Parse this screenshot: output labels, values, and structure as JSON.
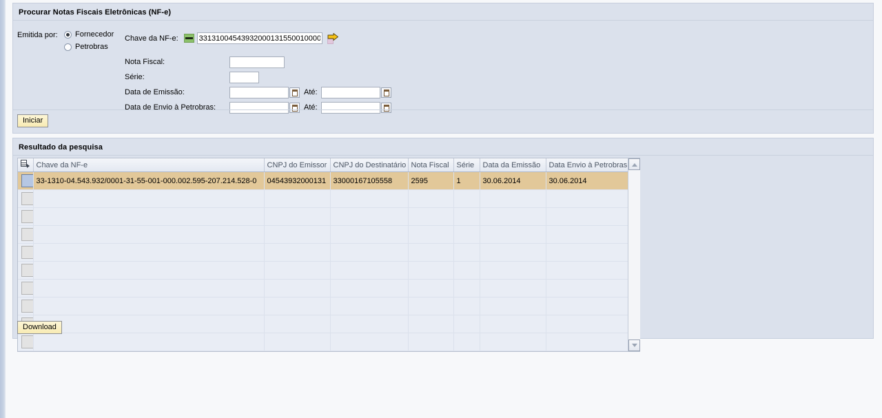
{
  "search_panel": {
    "title": "Procurar Notas Fiscais Eletrônicas (NF-e)",
    "emitida_por_label": "Emitida por:",
    "radios": [
      {
        "label": "Fornecedor",
        "checked": true
      },
      {
        "label": "Petrobras",
        "checked": false
      }
    ],
    "chave": {
      "label": "Chave da NF-e:",
      "value": "33131004543932000131550010000",
      "placeholder": "",
      "key_icon": "green-key-icon",
      "go_icon": "yellow-arrow-icon"
    },
    "fields": [
      {
        "label": "Nota Fiscal:",
        "value": "",
        "type": "text"
      },
      {
        "label": "Série:",
        "value": "",
        "type": "text-small"
      },
      {
        "label": "Data de Emissão:",
        "value": "",
        "ate_label": "Até:",
        "value2": "",
        "type": "date-range"
      },
      {
        "label": "Data de Envio à Petrobras:",
        "value": "",
        "ate_label": "Até:",
        "value2": "",
        "type": "date-range"
      }
    ],
    "start_button": "Iniciar"
  },
  "result_panel": {
    "title": "Resultado da pesquisa",
    "settings_icon": "table-settings-icon",
    "columns": [
      "Chave da NF-e",
      "CNPJ do Emissor",
      "CNPJ do Destinatário",
      "Nota Fiscal",
      "Série",
      "Data da Emissão",
      "Data Envio à Petrobras"
    ],
    "rows": [
      {
        "selected": true,
        "cells": [
          "33-1310-04.543.932/0001-31-55-001-000.002.595-207.214.528-0",
          "04543932000131",
          "33000167105558",
          "2595",
          "1",
          "30.06.2014",
          "30.06.2014"
        ]
      },
      {
        "selected": false,
        "cells": [
          "",
          "",
          "",
          "",
          "",
          "",
          ""
        ]
      },
      {
        "selected": false,
        "cells": [
          "",
          "",
          "",
          "",
          "",
          "",
          ""
        ]
      },
      {
        "selected": false,
        "cells": [
          "",
          "",
          "",
          "",
          "",
          "",
          ""
        ]
      },
      {
        "selected": false,
        "cells": [
          "",
          "",
          "",
          "",
          "",
          "",
          ""
        ]
      },
      {
        "selected": false,
        "cells": [
          "",
          "",
          "",
          "",
          "",
          "",
          ""
        ]
      },
      {
        "selected": false,
        "cells": [
          "",
          "",
          "",
          "",
          "",
          "",
          ""
        ]
      },
      {
        "selected": false,
        "cells": [
          "",
          "",
          "",
          "",
          "",
          "",
          ""
        ]
      },
      {
        "selected": false,
        "cells": [
          "",
          "",
          "",
          "",
          "",
          "",
          ""
        ]
      },
      {
        "selected": false,
        "cells": [
          "",
          "",
          "",
          "",
          "",
          "",
          ""
        ]
      }
    ],
    "download_button": "Download",
    "scroll_up_icon": "scroll-up-arrow-icon",
    "scroll_down_icon": "scroll-down-arrow-icon"
  },
  "colors": {
    "panel_bg": "#dbe1ec",
    "selected_row": "#e2c899",
    "button_bg": "#f8ebb4",
    "row_bg": "#e9edf5",
    "accent_green": "#8cc16a",
    "accent_yellow": "#f5c015"
  }
}
